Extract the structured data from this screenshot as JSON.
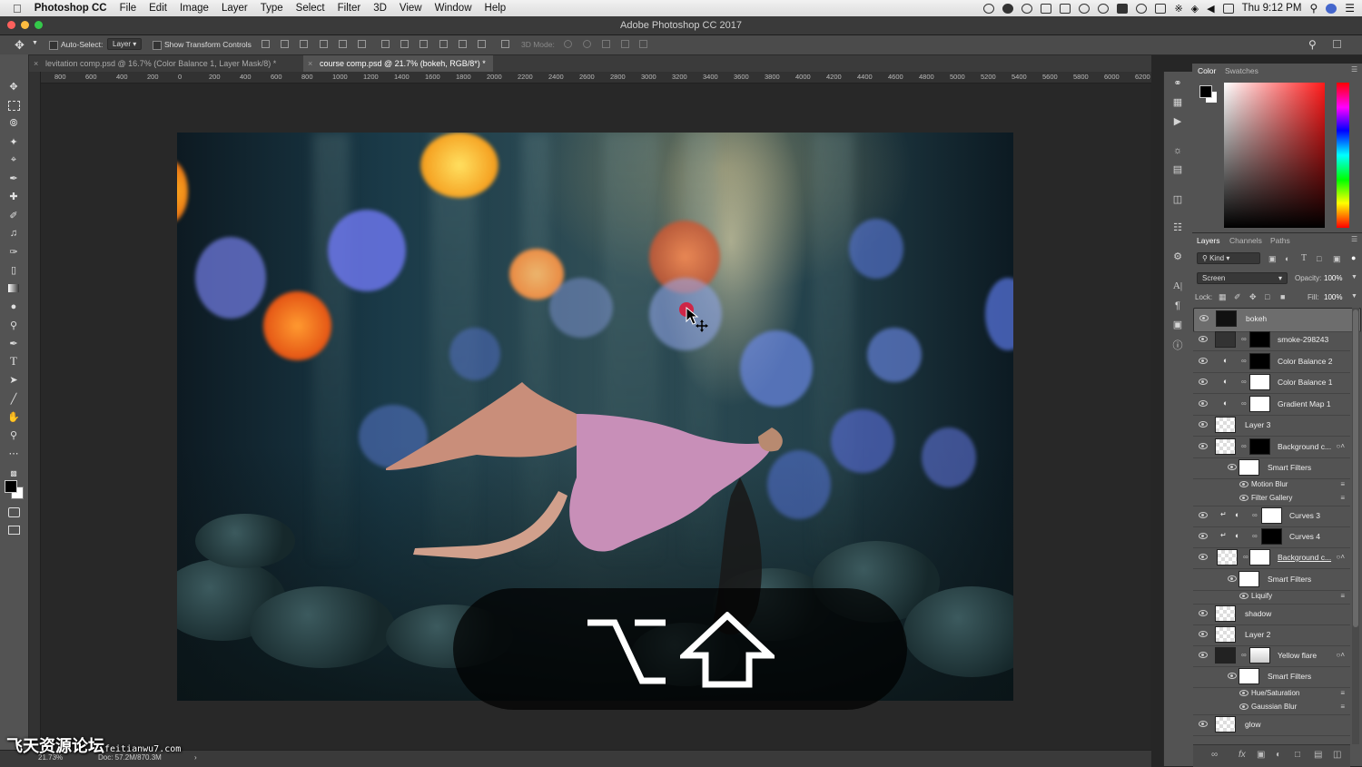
{
  "menubar": {
    "app_name": "Photoshop CC",
    "items": [
      "File",
      "Edit",
      "Image",
      "Layer",
      "Type",
      "Select",
      "Filter",
      "3D",
      "View",
      "Window",
      "Help"
    ],
    "clock": "Thu 9:12 PM"
  },
  "window": {
    "title": "Adobe Photoshop CC 2017"
  },
  "options": {
    "auto_select_label": "Auto-Select:",
    "auto_select_value": "Layer",
    "show_transform_label": "Show Transform Controls",
    "mode_3d_label": "3D Mode:"
  },
  "tabs": [
    {
      "label": "levitation comp.psd @ 16.7% (Color Balance 1, Layer Mask/8) *",
      "active": false
    },
    {
      "label": "course comp.psd @ 21.7% (bokeh, RGB/8*) *",
      "active": true
    }
  ],
  "ruler": {
    "ticks": [
      "800",
      "600",
      "400",
      "200",
      "0",
      "200",
      "400",
      "600",
      "800",
      "1000",
      "1200",
      "1400",
      "1600",
      "1800",
      "2000",
      "2200",
      "2400",
      "2600",
      "2800",
      "3000",
      "3200",
      "3400",
      "3600",
      "3800",
      "4000",
      "4200",
      "4400",
      "4600",
      "4800",
      "5000",
      "5200",
      "5400",
      "5600",
      "5800",
      "6000",
      "6200"
    ]
  },
  "overlay": {
    "keys": [
      "option-key-icon",
      "shift-key-icon"
    ]
  },
  "color_panel": {
    "tabs": [
      "Color",
      "Swatches"
    ],
    "foreground": "#000000",
    "background": "#ffffff"
  },
  "layers_panel": {
    "tabs": [
      "Layers",
      "Channels",
      "Paths"
    ],
    "filter_label": "Kind",
    "blend_mode": "Screen",
    "opacity_label": "Opacity:",
    "opacity_value": "100%",
    "lock_label": "Lock:",
    "fill_label": "Fill:",
    "fill_value": "100%",
    "layers": [
      {
        "name": "bokeh"
      },
      {
        "name": "smoke-298243"
      },
      {
        "name": "Color Balance 2"
      },
      {
        "name": "Color Balance 1"
      },
      {
        "name": "Gradient Map 1"
      },
      {
        "name": "Layer 3"
      },
      {
        "name": "Background c..."
      },
      {
        "name": "Smart Filters"
      },
      {
        "name": "Motion Blur"
      },
      {
        "name": "Filter Gallery"
      },
      {
        "name": "Curves 3"
      },
      {
        "name": "Curves 4"
      },
      {
        "name": "Background c..."
      },
      {
        "name": "Smart Filters"
      },
      {
        "name": "Liquify"
      },
      {
        "name": "shadow"
      },
      {
        "name": "Layer 2"
      },
      {
        "name": "Yellow flare"
      },
      {
        "name": "Smart Filters"
      },
      {
        "name": "Hue/Saturation"
      },
      {
        "name": "Gaussian Blur"
      },
      {
        "name": "glow"
      }
    ]
  },
  "status": {
    "zoom": "21.73%",
    "doc": "Doc: 57.2M/870.3M"
  },
  "watermark": {
    "text": "飞天资源论坛",
    "url": "feitianwu7.com"
  }
}
